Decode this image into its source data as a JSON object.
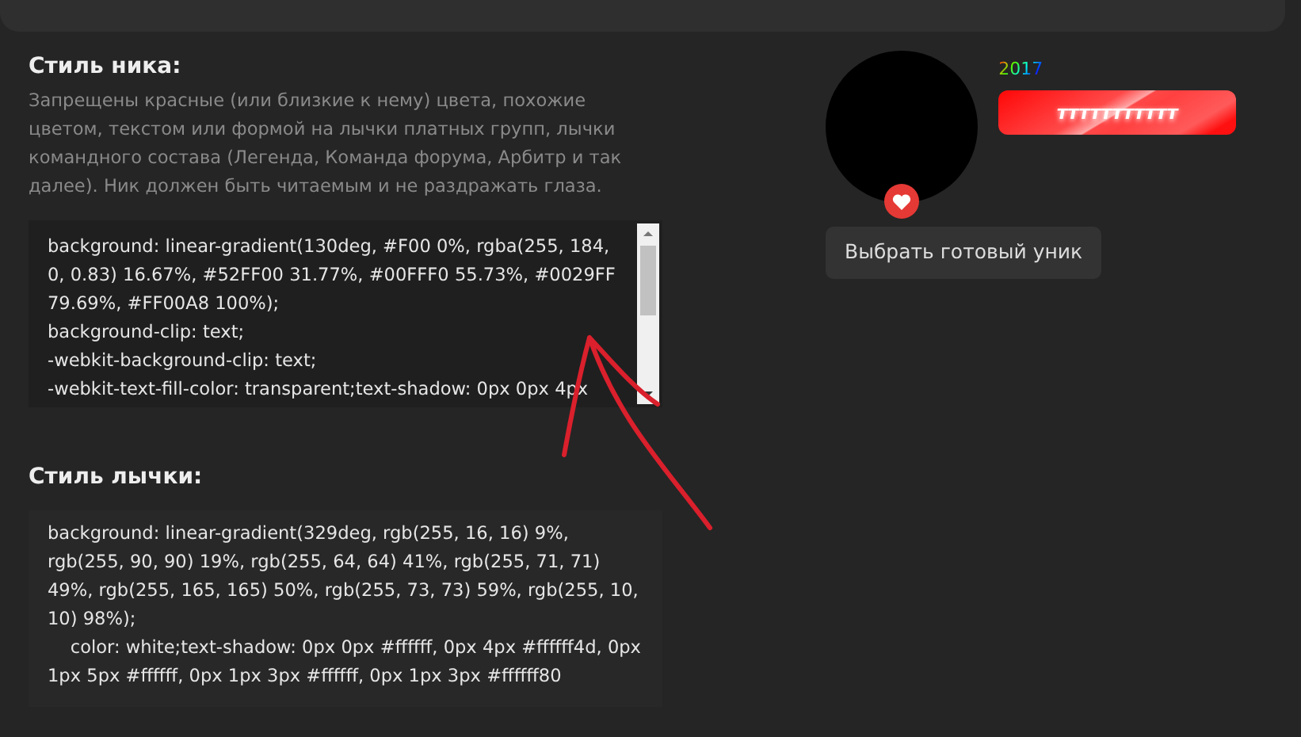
{
  "nick_style": {
    "title": "Стиль ника:",
    "description": "Запрещены красные (или близкие к нему) цвета, похожие цветом, текстом или формой на лычки платных групп, лычки командного состава (Легенда, Команда форума, Арбитр и так далее). Ник должен быть читаемым и не раздражать глаза.",
    "code": "background: linear-gradient(130deg, #F00 0%, rgba(255, 184, 0, 0.83) 16.67%, #52FF00 31.77%, #00FFF0 55.73%, #0029FF 79.69%, #FF00A8 100%);\nbackground-clip: text;\n-webkit-background-clip: text;\n-webkit-text-fill-color: transparent;text-shadow: 0px 0px 4px"
  },
  "badge_style": {
    "title": "Стиль лычки:",
    "code": "background: linear-gradient(329deg, rgb(255, 16, 16) 9%, rgb(255, 90, 90) 19%, rgb(255, 64, 64) 41%, rgb(255, 71, 71) 49%, rgb(255, 165, 165) 50%, rgb(255, 73, 73) 59%, rgb(255, 10, 10) 98%);\n    color: white;text-shadow: 0px 0px #ffffff, 0px 4px #ffffff4d, 0px 1px 5px #ffffff, 0px 1px 3px #ffffff, 0px 1px 3px #ffffff80"
  },
  "preview": {
    "nickname": "2017",
    "badge": "ттттттттттт",
    "button": "Выбрать готовый уник"
  }
}
